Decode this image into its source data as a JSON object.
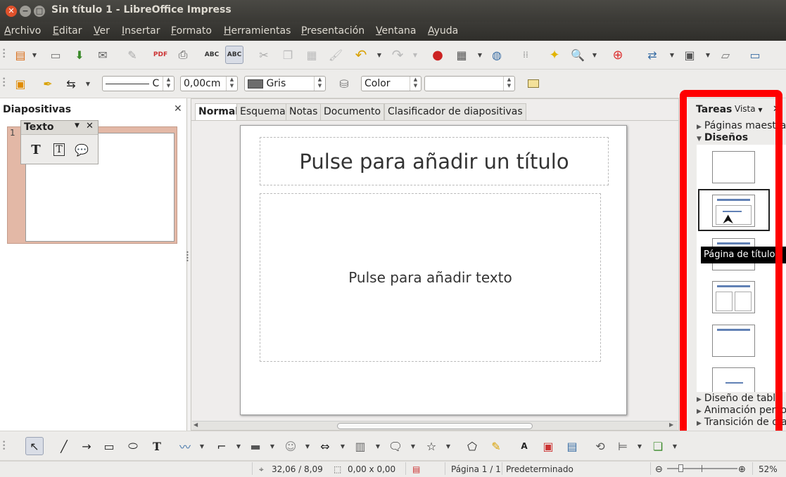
{
  "window": {
    "title": "Sin título 1 - LibreOffice Impress"
  },
  "menu": [
    "Archivo",
    "Editar",
    "Ver",
    "Insertar",
    "Formato",
    "Herramientas",
    "Presentación",
    "Ventana",
    "Ayuda"
  ],
  "line_props": {
    "width_value": "0,00cm",
    "color_name": "Gris",
    "area_style": "Color",
    "line_style_suffix": "C"
  },
  "slides_panel": {
    "title": "Diapositivas",
    "slide_number": "1"
  },
  "text_toolbar": {
    "title": "Texto"
  },
  "view_tabs": [
    "Normal",
    "Esquema",
    "Notas",
    "Documento",
    "Clasificador de diapositivas"
  ],
  "slide": {
    "title_placeholder": "Pulse para añadir un título",
    "content_placeholder": "Pulse para añadir texto"
  },
  "tasks_panel": {
    "title": "Tareas",
    "view_menu": "Vista",
    "sections": [
      "Páginas maestras",
      "Diseños",
      "Diseño de tabla",
      "Animación personalizada",
      "Transición de diapositivas"
    ],
    "tooltip": "Página de título"
  },
  "statusbar": {
    "position": "32,06 / 8,09",
    "size": "0,00 x 0,00",
    "page": "Página 1 / 1",
    "master": "Predeterminado",
    "zoom": "52%",
    "zoom_level": 0.52
  },
  "colors": {
    "highlight": "#ff0000",
    "slide_thumb_bg": "#e3b8a6",
    "layout_line": "#6181b5"
  }
}
